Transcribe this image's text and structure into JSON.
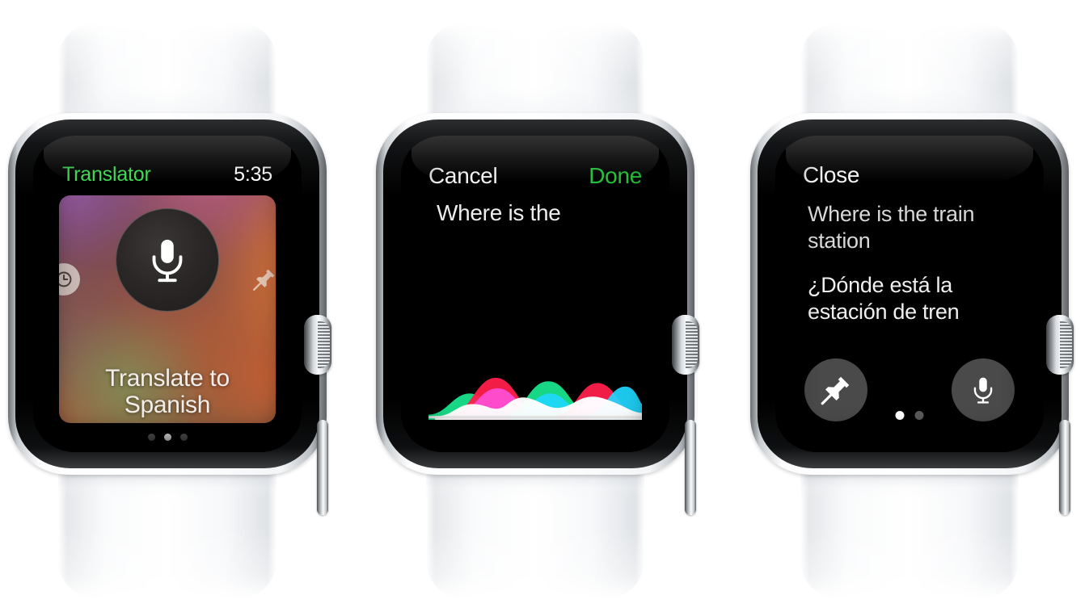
{
  "scene": {
    "background_color": "#ffffff",
    "device_name": "apple-watch",
    "band_color": "#ffffff",
    "case_color": "#e8eaec",
    "accent_green": "#2ac13a"
  },
  "watches": [
    {
      "id": "watch-translator-home",
      "screen": {
        "status_bar": {
          "app_title": "Translator",
          "app_title_color": "#3ddb53",
          "time": "5:35",
          "time_color": "#ffffff"
        },
        "card": {
          "left_icon_name": "clock-icon",
          "right_icon_name": "pin-icon",
          "center_button_name": "microphone-button",
          "caption": "Translate to Spanish"
        },
        "page_dots": {
          "count": 3,
          "active_index": 1
        }
      }
    },
    {
      "id": "watch-dictation",
      "screen": {
        "nav": {
          "cancel_label": "Cancel",
          "cancel_color": "#f2f2f2",
          "done_label": "Done",
          "done_color": "#22c13a"
        },
        "dictated_text": "Where is the",
        "waveform": {
          "name": "siri-waveform",
          "baseline_color": "#e6e6e6",
          "colors": [
            "#ff1f4b",
            "#ff4fd8",
            "#19e38b",
            "#1fd8ff",
            "#ffffff",
            "#3b6dff"
          ]
        }
      }
    },
    {
      "id": "watch-translation-result",
      "screen": {
        "close_label": "Close",
        "source_text": "Where is the train station",
        "target_text": "¿Dónde está la estación de tren",
        "actions": [
          {
            "name": "pin-button",
            "icon": "pin-icon"
          },
          {
            "name": "microphone-button",
            "icon": "microphone-icon"
          }
        ],
        "page_dots": {
          "count": 2,
          "active_index": 0
        }
      }
    }
  ]
}
